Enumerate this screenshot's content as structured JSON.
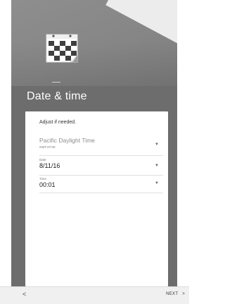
{
  "header": {
    "title": "Date & time",
    "illustration": "calendar-icon"
  },
  "card": {
    "hint": "Adjust if needed.",
    "timezone": {
      "name": "Pacific Daylight Time",
      "offset": "GMT-07:00",
      "icon": "dropdown-arrow-icon"
    },
    "date": {
      "label": "Date",
      "value": "8/11/16",
      "icon": "dropdown-arrow-icon"
    },
    "time": {
      "label": "Time",
      "value": "00:01",
      "icon": "dropdown-arrow-icon"
    }
  },
  "nav": {
    "back_symbol": "<",
    "next_label": "NEXT",
    "next_symbol": ">"
  }
}
